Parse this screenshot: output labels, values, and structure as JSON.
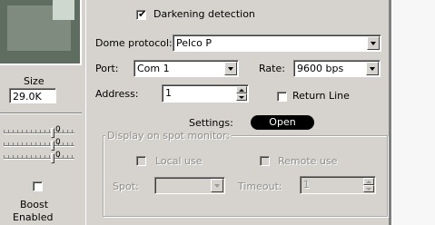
{
  "left_panel": {
    "size_label": "Size",
    "size_value": "29.0K",
    "slider_values": [
      "0",
      "0",
      "0"
    ],
    "boost_label": "Boost",
    "enabled_label": "Enabled"
  },
  "settings": {
    "darkening_label": "Darkening detection",
    "dome_protocol_label": "Dome protocol:",
    "dome_protocol_value": "Pelco P",
    "port_label": "Port:",
    "port_value": "Com 1",
    "rate_label": "Rate:",
    "rate_value": "9600 bps",
    "address_label": "Address:",
    "address_value": "1",
    "return_line_label": "Return Line",
    "settings_label": "Settings:",
    "open_button": "Open"
  },
  "spot_monitor": {
    "title": "Display on spot monitor:",
    "local_use_label": "Local use",
    "remote_use_label": "Remote use",
    "spot_label": "Spot:",
    "spot_value": "",
    "timeout_label": "Timeout:",
    "timeout_value": "1"
  },
  "icons": {
    "check": "✔"
  }
}
